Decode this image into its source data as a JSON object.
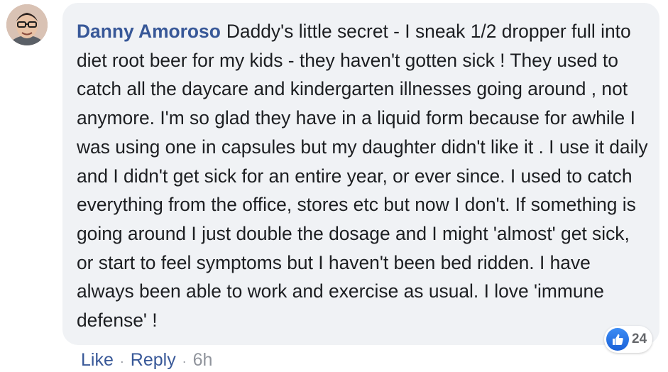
{
  "comment": {
    "author": "Danny Amoroso",
    "text": "Daddy's little secret - I sneak 1/2 dropper full into diet root beer for my kids - they haven't gotten sick ! They used to catch all the daycare and kindergarten illnesses going around , not anymore. I'm so glad they have in a liquid form because for awhile I was using one in capsules but my daughter didn't like it . I use it daily and I didn't get sick for an entire year, or ever since. I used to catch everything from the office, stores etc but now I don't. If something is going around I just double the dosage and I might 'almost' get sick, or start to feel symptoms but I haven't been bed ridden. I have always been able to work and exercise as usual. I love 'immune defense' !",
    "reaction_count": "24",
    "reaction_icon": "thumbs-up-icon"
  },
  "actions": {
    "like_label": "Like",
    "separator": "·",
    "reply_label": "Reply",
    "timestamp": "6h"
  },
  "colors": {
    "author": "#385898",
    "bubble": "#f0f2f5",
    "text": "#1c1e21",
    "meta": "#90949c",
    "like_blue": "#1877f2"
  }
}
